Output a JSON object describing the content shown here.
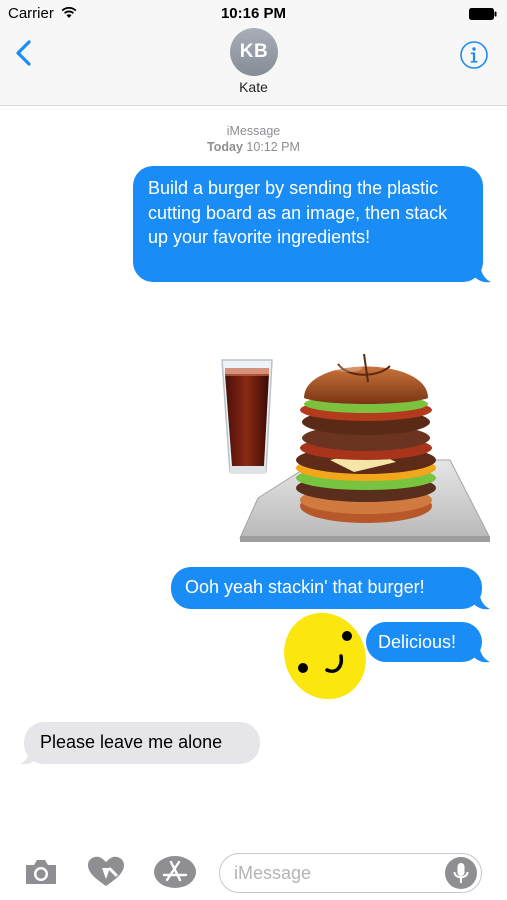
{
  "status_bar": {
    "carrier": "Carrier",
    "time": "10:16 PM",
    "icons": [
      "wifi-icon",
      "battery-icon"
    ]
  },
  "header": {
    "avatar_initials": "KB",
    "contact_name": "Kate",
    "icons": [
      "chevron-left-icon",
      "info-icon"
    ],
    "accent_color": "#1a8cf5"
  },
  "conversation": {
    "service": "iMessage",
    "timestamp_day": "Today",
    "timestamp_time": "10:12 PM",
    "messages": [
      {
        "direction": "outgoing",
        "text": "Build a burger by sending the plastic cutting board as an image, then stack up your favorite ingredients!"
      },
      {
        "direction": "outgoing",
        "type": "sticker",
        "sticker": "burger-and-soda"
      },
      {
        "direction": "outgoing",
        "text": "Ooh yeah stackin' that burger!"
      },
      {
        "direction": "outgoing",
        "type": "sticker",
        "sticker": "smiley-face"
      },
      {
        "direction": "outgoing",
        "text": "Delicious!"
      },
      {
        "direction": "incoming",
        "text": "Please leave me alone"
      }
    ],
    "colors": {
      "outgoing": "#1a8cf5",
      "incoming": "#e5e5ea"
    }
  },
  "input_bar": {
    "placeholder": "iMessage",
    "value": "",
    "icons": [
      "camera-icon",
      "digital-touch-icon",
      "app-store-icon",
      "microphone-icon"
    ]
  }
}
